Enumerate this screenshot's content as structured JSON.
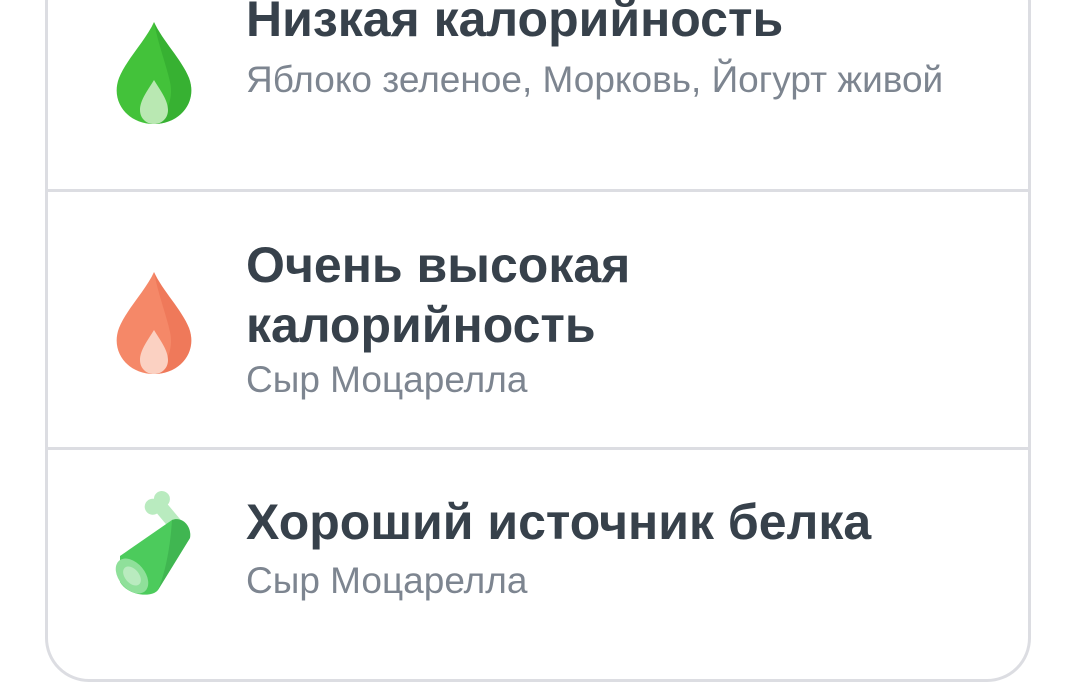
{
  "items": [
    {
      "title": "Низкая калорийность",
      "subtitle": "Яблоко зеленое, Морковь, Йогурт живой",
      "icon": "flame-icon",
      "color": "#43c23a"
    },
    {
      "title": "Очень высокая калорийность",
      "subtitle": "Сыр Моцарелла",
      "icon": "flame-icon",
      "color": "#f58868"
    },
    {
      "title": "Хороший источник белка",
      "subtitle": "Сыр Моцарелла",
      "icon": "meat-leg-icon",
      "color": "#4ccb5c"
    }
  ]
}
